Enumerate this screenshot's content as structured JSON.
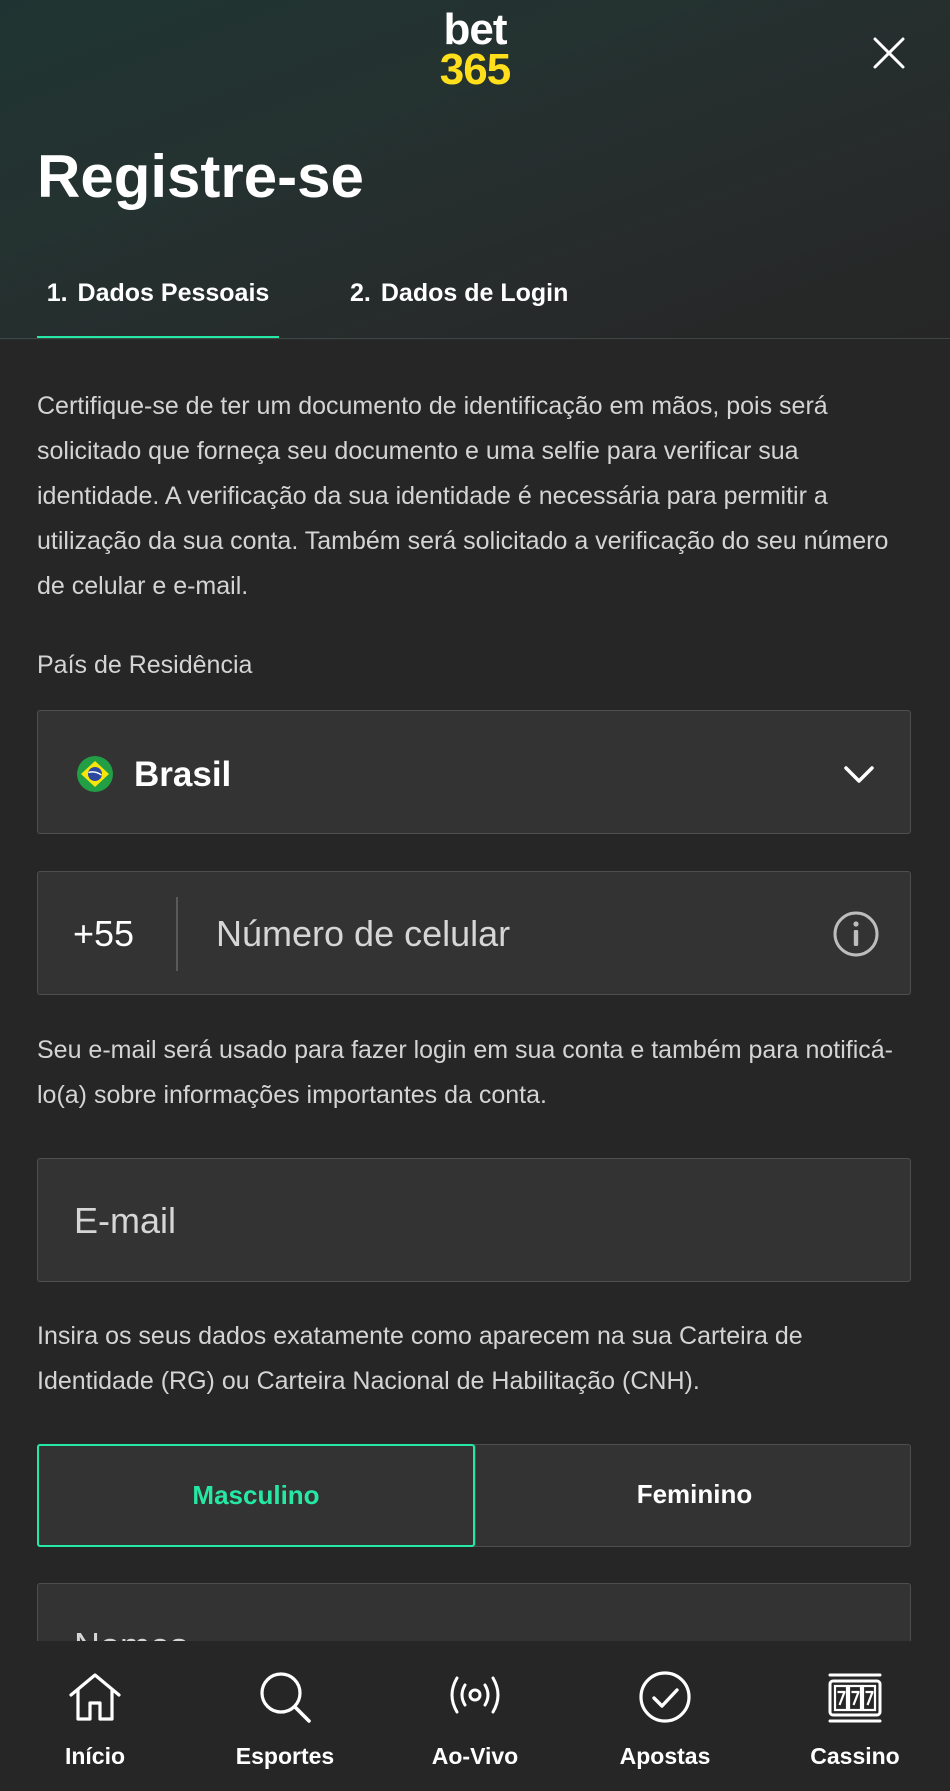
{
  "header": {
    "logo_top": "bet",
    "logo_bottom": "365",
    "close_icon": "close-icon"
  },
  "page_title": "Registre-se",
  "tabs": [
    {
      "number": "1.",
      "label": "Dados Pessoais",
      "active": true
    },
    {
      "number": "2.",
      "label": "Dados de Login",
      "active": false
    }
  ],
  "intro_text": "Certifique-se de ter um documento de identificação em mãos, pois será solicitado que forneça seu documento e uma selfie para verificar sua identidade. A verificação da sua identidade é necessária para permitir a utilização da sua conta. Também será solicitado a verificação do seu número de celular e e-mail.",
  "country": {
    "label": "País de Residência",
    "value": "Brasil",
    "flag_icon": "brazil-flag-icon",
    "dropdown_icon": "chevron-down-icon"
  },
  "phone": {
    "prefix": "+55",
    "placeholder": "Número de celular",
    "info_icon": "info-icon"
  },
  "email_note": "Seu e-mail será usado para fazer login em sua conta e também para notificá-lo(a) sobre informações importantes da conta.",
  "email": {
    "placeholder": "E-mail"
  },
  "id_note": "Insira os seus dados exatamente como aparecem na sua Carteira de Identidade (RG) ou Carteira Nacional de Habilitação (CNH).",
  "gender": {
    "options": [
      "Masculino",
      "Feminino"
    ],
    "selected": "Masculino"
  },
  "name": {
    "placeholder": "Nomes"
  },
  "bottom_nav": [
    {
      "label": "Início",
      "icon": "home-icon"
    },
    {
      "label": "Esportes",
      "icon": "search-icon"
    },
    {
      "label": "Ao-Vivo",
      "icon": "live-broadcast-icon"
    },
    {
      "label": "Apostas",
      "icon": "check-circle-icon"
    },
    {
      "label": "Cassino",
      "icon": "slot-machine-icon"
    }
  ],
  "colors": {
    "accent": "#26e8a5",
    "logo_yellow": "#ffdf1b",
    "background": "#262626",
    "field_background": "#333333"
  }
}
